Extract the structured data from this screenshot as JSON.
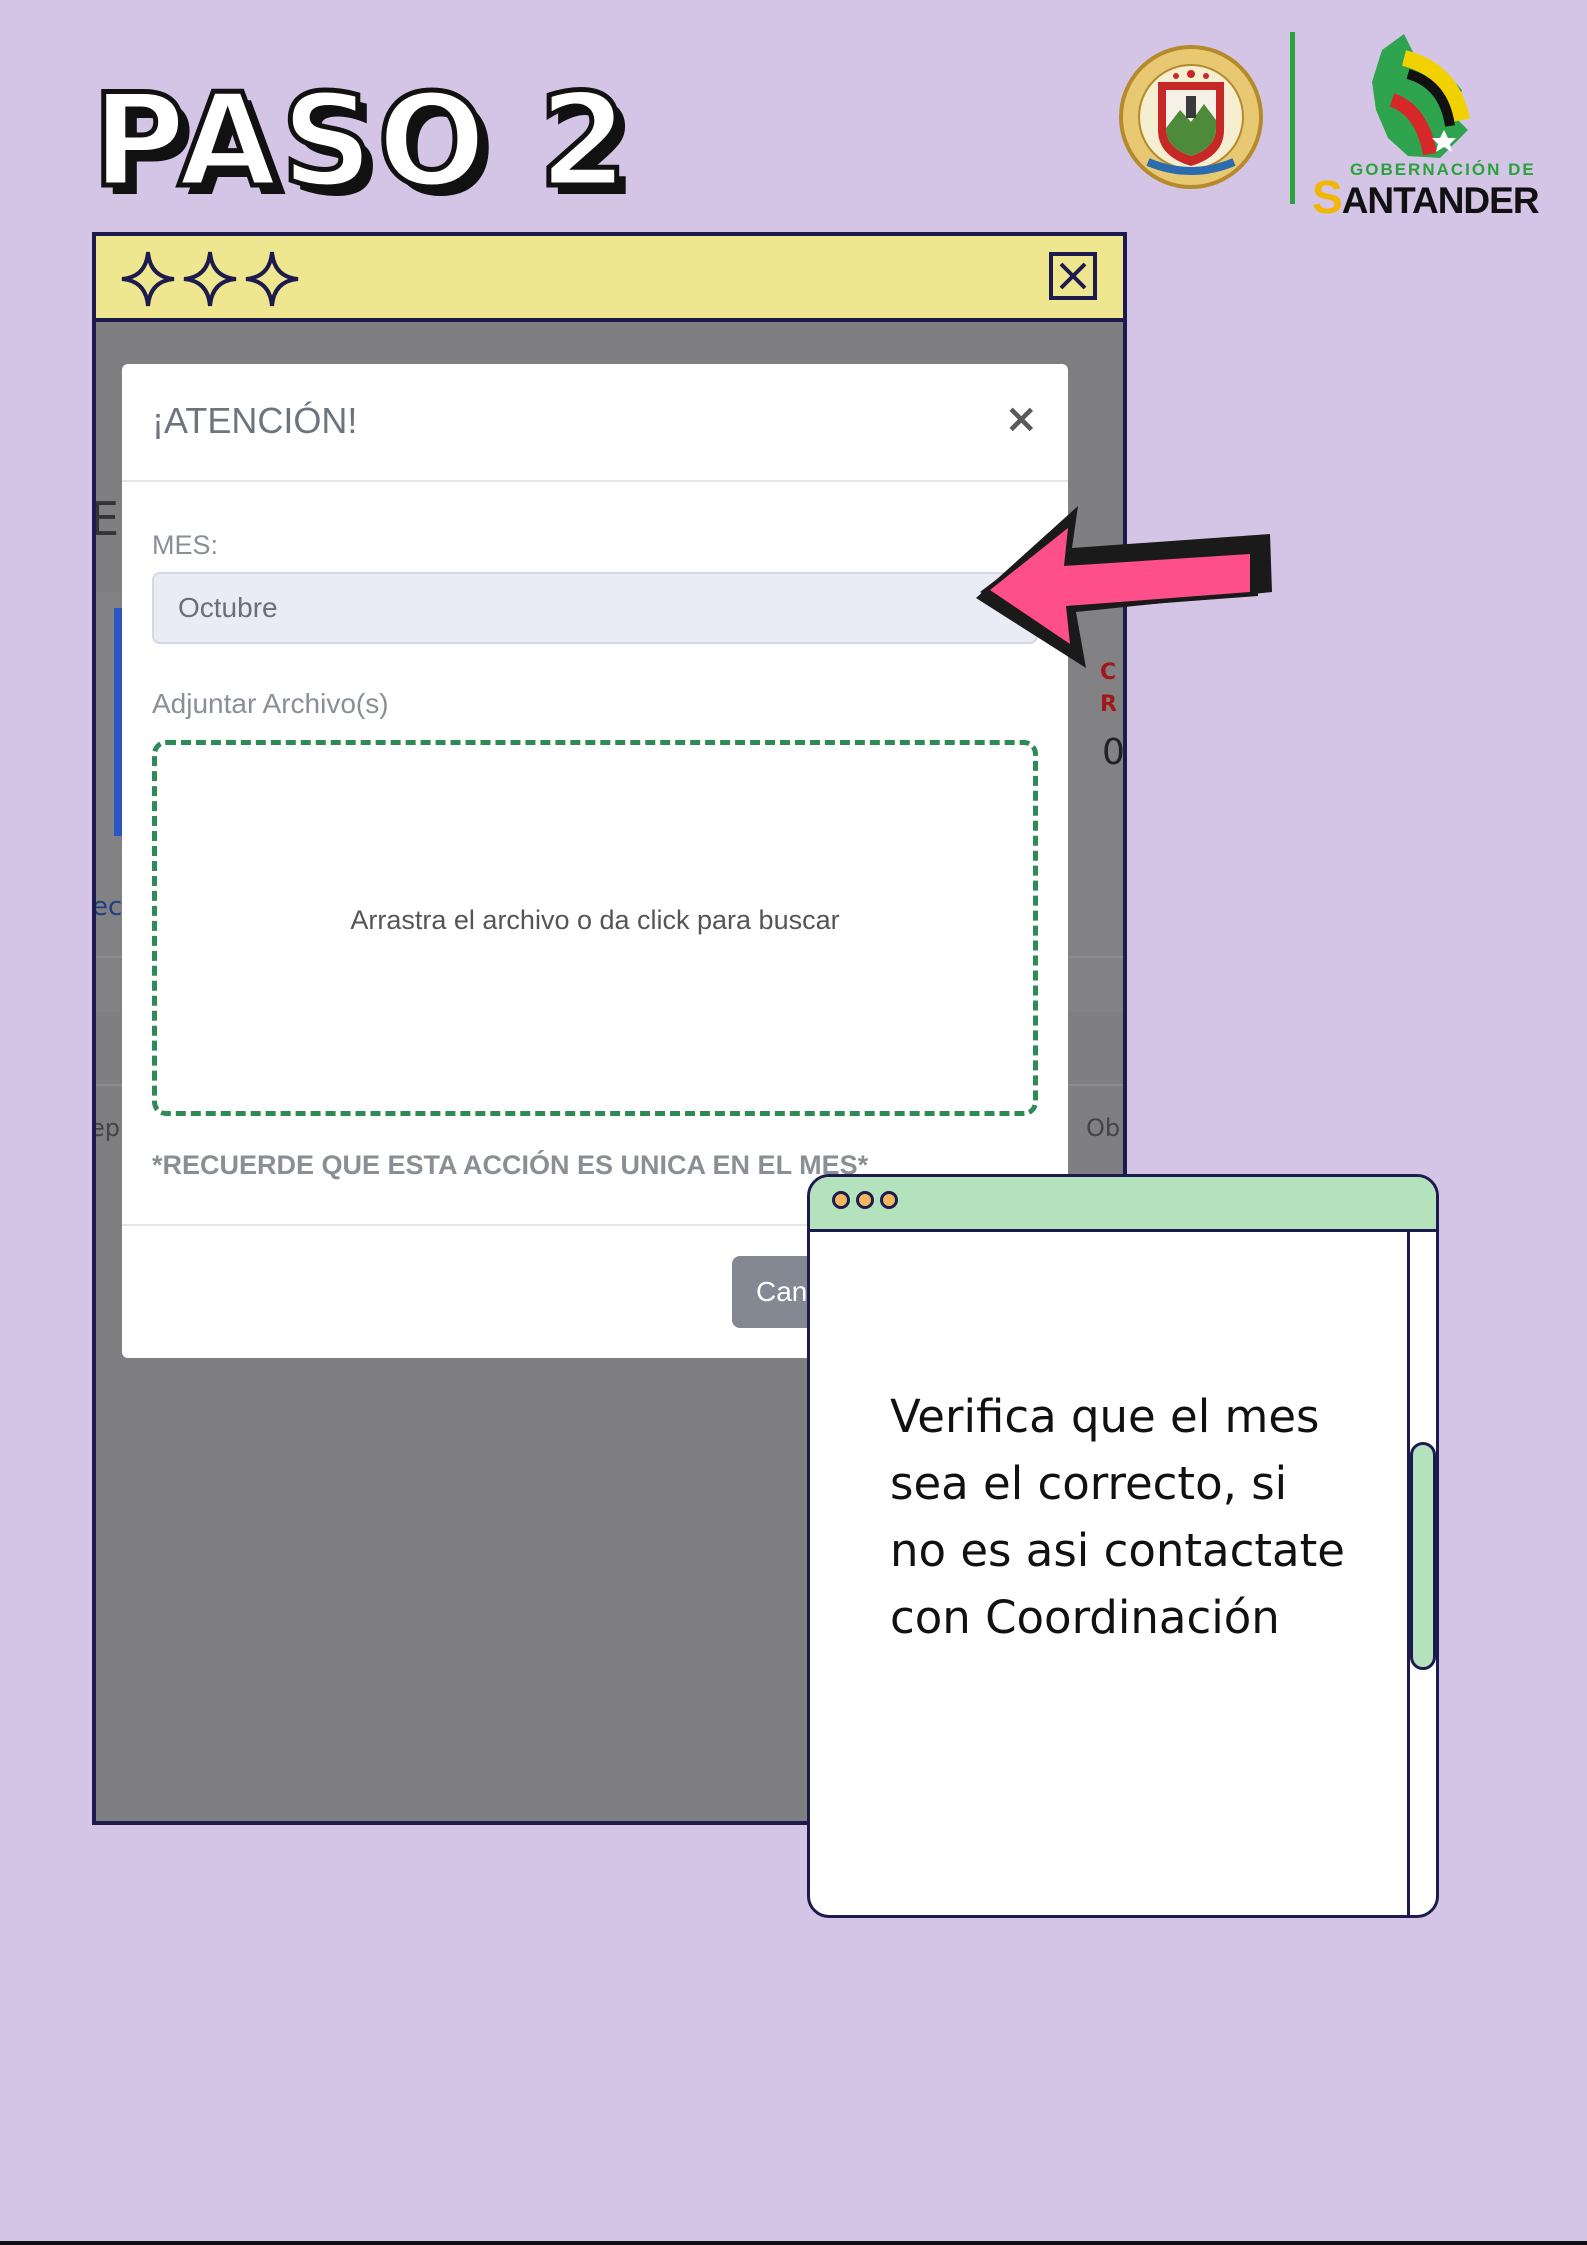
{
  "title": "PASO 2",
  "logos": {
    "seal_text_top": "DEPARTAMENTO DE SANTANDER",
    "seal_text_bottom": "SIEMPRE ADELANTE",
    "gob_small": "GOBERNACIÓN DE",
    "gob_big_initial": "S",
    "gob_big_rest": "ANTANDER",
    "accent_green": "#27a33a",
    "accent_yellow": "#f2b705"
  },
  "window": {
    "bar_color": "#eee78f",
    "border_color": "#1d1a4e",
    "icons": [
      "sparkle-icon",
      "sparkle-icon",
      "sparkle-icon",
      "close-icon"
    ],
    "background_fragments": [
      "E",
      "C",
      "R",
      "0",
      "ec",
      "ep",
      "Ob"
    ]
  },
  "modal": {
    "title": "¡ATENCIÓN!",
    "close_symbol": "×",
    "mes_label": "MES:",
    "mes_value": "Octubre",
    "attach_label": "Adjuntar Archivo(s)",
    "dropzone_text": "Arrastra el archivo o da click para buscar",
    "reminder": "*RECUERDE QUE ESTA ACCIÓN ES UNICA EN EL MES*",
    "cancel_label": "Can",
    "dropzone_border_color": "#2e8b57"
  },
  "arrow": {
    "color": "#ff4f8b",
    "icon": "arrow-left-icon"
  },
  "note": {
    "bar_color": "#b4e2bd",
    "dot_color": "#f6b760",
    "text": "Verifica que el mes sea el correcto, si no es asi contactate con Coordinación"
  }
}
